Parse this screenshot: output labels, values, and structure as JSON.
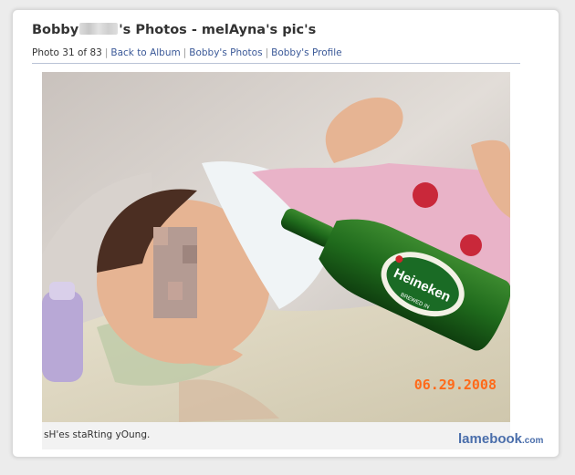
{
  "header": {
    "title_prefix": "Bobby",
    "title_suffix": "'s Photos - melAyna's pic's"
  },
  "subnav": {
    "photo_counter": "Photo 31 of 83",
    "back_to_album": "Back to Album",
    "user_photos": "Bobby's Photos",
    "user_profile": "Bobby's Profile",
    "separator": "|"
  },
  "photo": {
    "date_stamp": "06.29.2008",
    "bottle_label": "Heineken",
    "bottle_sublabel": "BREWED IN"
  },
  "caption": "sH'es staRting yOung.",
  "watermark": {
    "name": "lamebook",
    "tld": ".com"
  },
  "colors": {
    "link": "#3b5998",
    "brand": "#4a6eab",
    "date_stamp": "#ff6a1a"
  }
}
